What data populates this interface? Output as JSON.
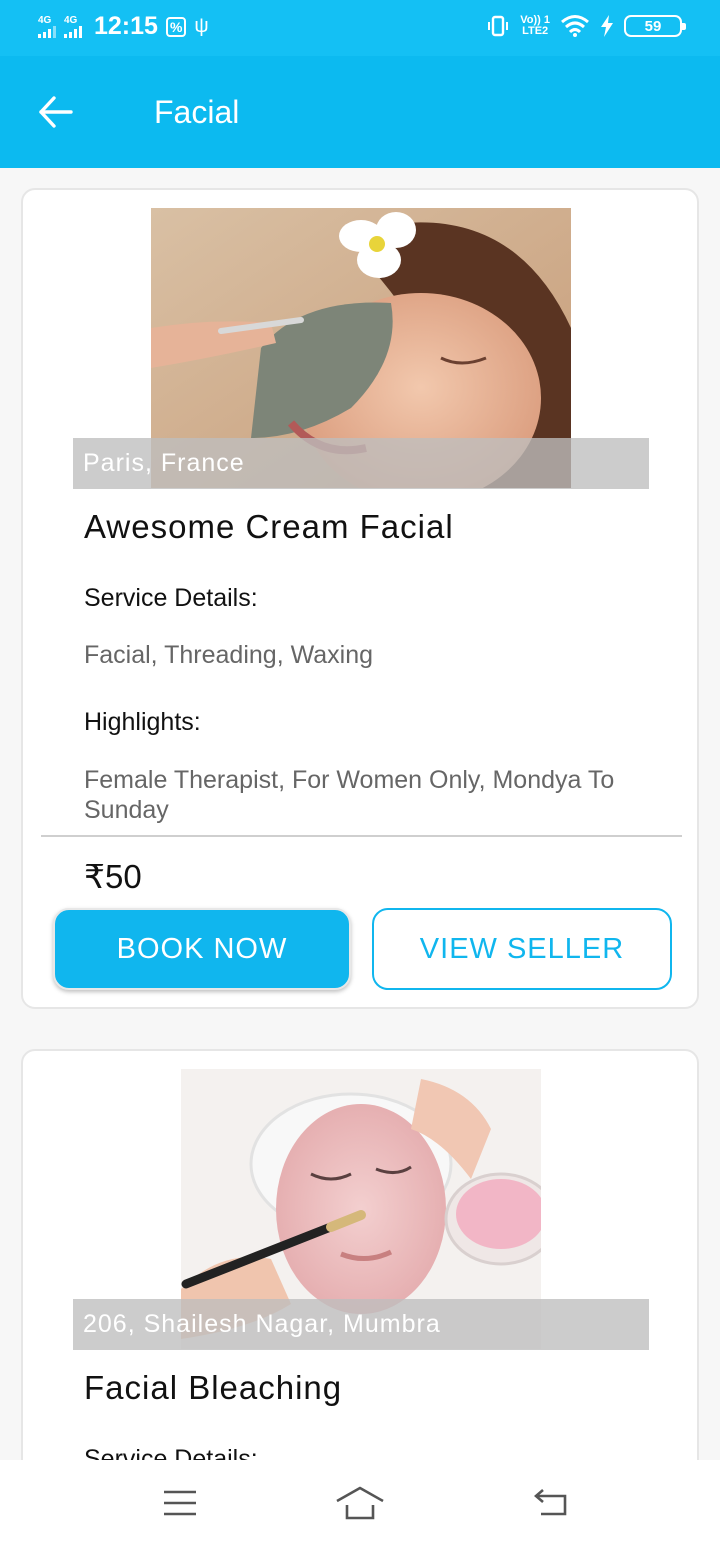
{
  "status_bar": {
    "network1": "4G",
    "network2": "4G",
    "time": "12:15",
    "volte_top": "Vo)) 1",
    "volte_bottom": "LTE2",
    "battery": "59"
  },
  "app_bar": {
    "title": "Facial"
  },
  "listings": [
    {
      "location": "Paris, France",
      "title": "Awesome Cream Facial",
      "service_label": "Service Details:",
      "service_value": "Facial, Threading, Waxing",
      "highlights_label": "Highlights:",
      "highlights_value": "Female Therapist, For Women Only, Mondya To Sunday",
      "price": "₹50",
      "book_label": "BOOK NOW",
      "view_label": "VIEW SELLER"
    },
    {
      "location": "206, Shailesh Nagar, Mumbra",
      "title": "Facial Bleaching",
      "service_label": "Service Details:"
    }
  ],
  "colors": {
    "status_bar": "#14c0f4",
    "app_bar": "#0cbaf0",
    "accent": "#10b6ee"
  }
}
